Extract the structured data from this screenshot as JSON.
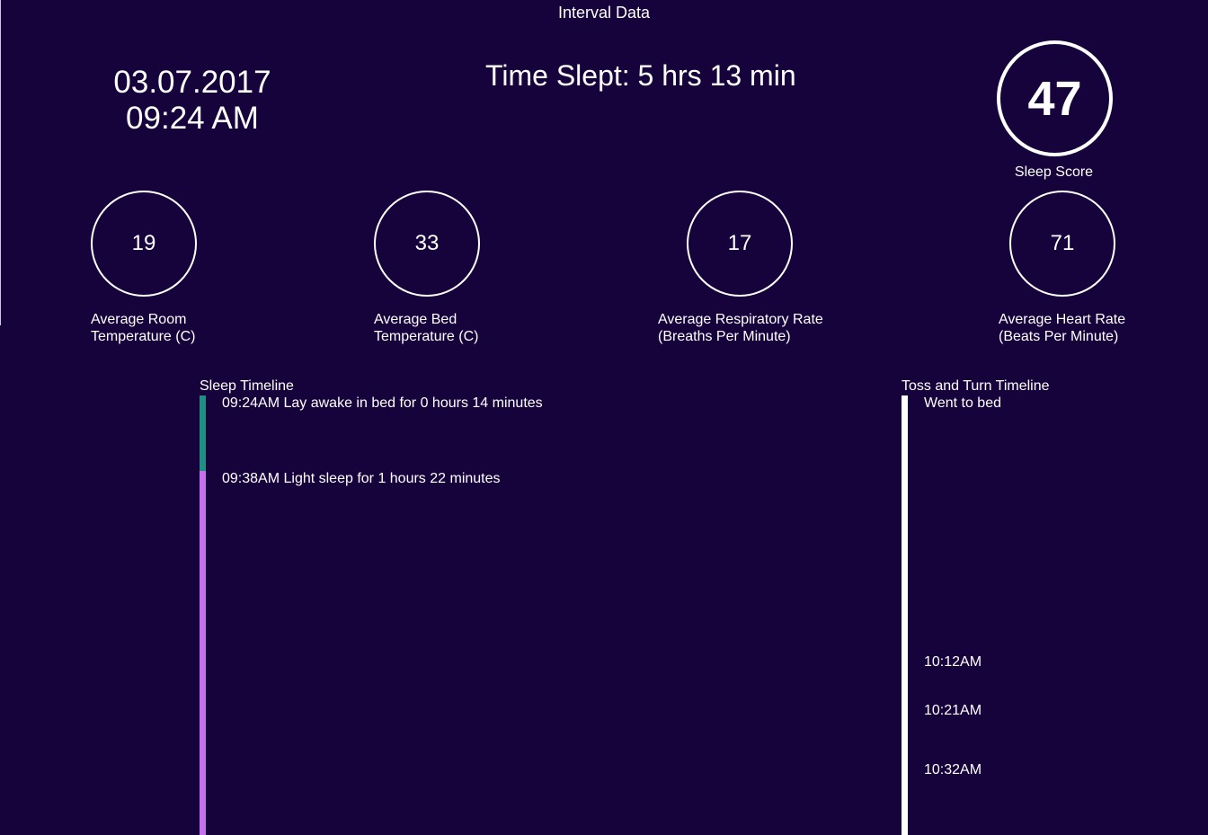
{
  "header": {
    "title": "Interval Data",
    "date": "03.07.2017",
    "time": "09:24 AM",
    "time_slept": "Time Slept: 5 hrs 13 min"
  },
  "sleep_score": {
    "value": "47",
    "label": "Sleep Score"
  },
  "stats": [
    {
      "value": "19",
      "label": "Average Room\nTemperature (C)"
    },
    {
      "value": "33",
      "label": "Average Bed\nTemperature (C)"
    },
    {
      "value": "17",
      "label": "Average Respiratory Rate\n(Breaths Per Minute)"
    },
    {
      "value": "71",
      "label": "Average Heart Rate\n(Beats Per Minute)"
    }
  ],
  "sleep_timeline": {
    "heading": "Sleep Timeline",
    "events": [
      {
        "text": "09:24AM Lay awake in bed for 0 hours 14 minutes",
        "stage": "awake"
      },
      {
        "text": "09:38AM Light sleep for 1 hours 22 minutes",
        "stage": "light"
      }
    ]
  },
  "toss_turn_timeline": {
    "heading": "Toss and Turn Timeline",
    "events": [
      "Went to bed",
      "10:12AM",
      "10:21AM",
      "10:32AM"
    ]
  },
  "colors": {
    "background": "#17033b",
    "awake": "#1f8f86",
    "light_sleep": "#c86ff0",
    "toss_line": "#ffffff"
  }
}
